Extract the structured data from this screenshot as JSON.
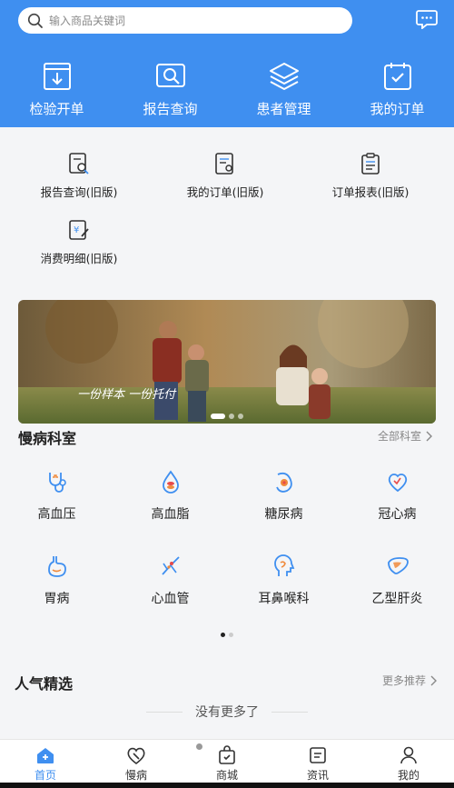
{
  "search": {
    "placeholder": "输入商品关键词",
    "icon": "search-icon"
  },
  "header": {
    "message_icon": "chat-icon",
    "nav": [
      {
        "label": "检验开单",
        "icon": "download-doc-icon"
      },
      {
        "label": "报告查询",
        "icon": "search-screen-icon"
      },
      {
        "label": "患者管理",
        "icon": "layers-icon"
      },
      {
        "label": "我的订单",
        "icon": "check-clipboard-icon"
      }
    ]
  },
  "old_menu": [
    {
      "label": "报告查询(旧版)",
      "icon": "report-search-icon"
    },
    {
      "label": "我的订单(旧版)",
      "icon": "order-doc-icon"
    },
    {
      "label": "订单报表(旧版)",
      "icon": "clipboard-list-icon"
    },
    {
      "label": "消费明细(旧版)",
      "icon": "yen-edit-icon"
    }
  ],
  "banner": {
    "caption": "一份样本 一份托付",
    "slides": 3,
    "active": 0
  },
  "chronic": {
    "title": "慢病科室",
    "more": "全部科室",
    "departments": [
      {
        "label": "高血压",
        "icon": "stethoscope-icon"
      },
      {
        "label": "高血脂",
        "icon": "blood-drop-icon"
      },
      {
        "label": "糖尿病",
        "icon": "pancreas-icon"
      },
      {
        "label": "冠心病",
        "icon": "heart-icon"
      },
      {
        "label": "胃病",
        "icon": "stomach-icon"
      },
      {
        "label": "心血管",
        "icon": "blood-vessel-icon"
      },
      {
        "label": "耳鼻喉科",
        "icon": "ent-head-icon"
      },
      {
        "label": "乙型肝炎",
        "icon": "liver-icon"
      }
    ],
    "pages": 2,
    "active_page": 0
  },
  "popular": {
    "title": "人气精选",
    "more": "更多推荐",
    "empty": "没有更多了"
  },
  "tabbar": [
    {
      "label": "首页",
      "icon": "home-icon",
      "active": true
    },
    {
      "label": "慢病",
      "icon": "pill-heart-icon"
    },
    {
      "label": "商城",
      "icon": "shopping-bag-icon"
    },
    {
      "label": "资讯",
      "icon": "news-icon"
    },
    {
      "label": "我的",
      "icon": "user-icon"
    }
  ],
  "colors": {
    "primary": "#3f8ff0",
    "accent_orange": "#f08a3c",
    "accent_red": "#e84a4a"
  }
}
